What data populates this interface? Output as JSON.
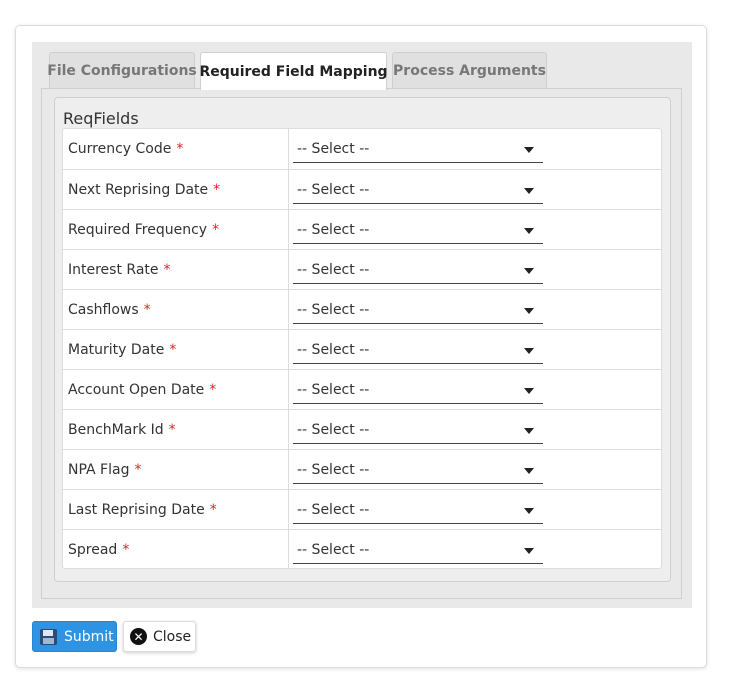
{
  "tabs": [
    {
      "label": "File Configurations",
      "active": false
    },
    {
      "label": "Required Field Mapping",
      "active": true
    },
    {
      "label": "Process Arguments",
      "active": false
    }
  ],
  "fieldset": {
    "legend": "ReqFields",
    "required_marker": "*",
    "rows": [
      {
        "label": "Currency Code",
        "value": "-- Select --"
      },
      {
        "label": "Next Reprising Date",
        "value": "-- Select --"
      },
      {
        "label": "Required Frequency",
        "value": "-- Select --"
      },
      {
        "label": "Interest Rate",
        "value": "-- Select --"
      },
      {
        "label": "Cashflows",
        "value": "-- Select --"
      },
      {
        "label": "Maturity Date",
        "value": "-- Select --"
      },
      {
        "label": "Account Open Date",
        "value": "-- Select --"
      },
      {
        "label": "BenchMark Id",
        "value": "-- Select --"
      },
      {
        "label": "NPA Flag",
        "value": "-- Select --"
      },
      {
        "label": "Last Reprising Date",
        "value": "-- Select --"
      },
      {
        "label": "Spread",
        "value": "-- Select --"
      }
    ]
  },
  "buttons": {
    "submit_label": "Submit",
    "close_label": "Close",
    "close_icon_glyph": "✕"
  },
  "icons": {
    "submit": "floppy-disk-icon",
    "close": "close-circle-icon",
    "dropdown": "caret-down-icon"
  },
  "colors": {
    "accent": "#2e93e2",
    "required": "#e0202a"
  }
}
